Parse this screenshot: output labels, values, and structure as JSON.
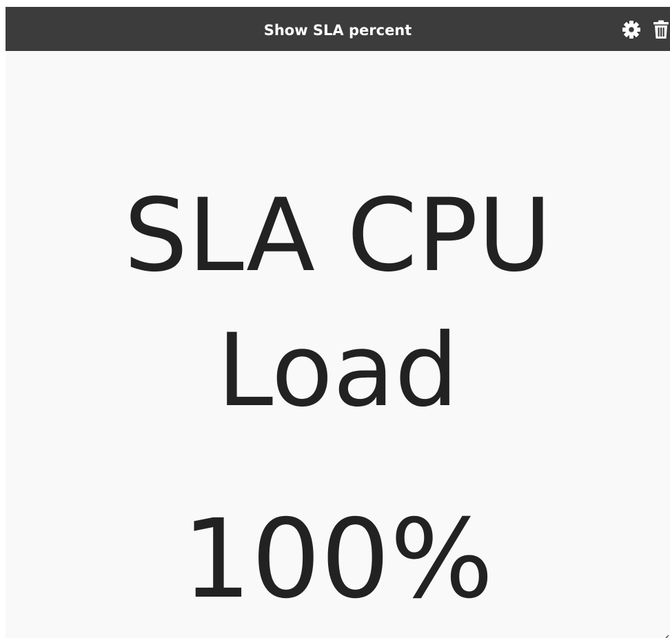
{
  "widget": {
    "title": "Show SLA percent",
    "icons": {
      "settings": "gear-icon",
      "delete": "trash-icon",
      "resize": "resize-handle-icon"
    },
    "sla": {
      "label": "SLA CPU Load",
      "value": "100%"
    }
  },
  "colors": {
    "header_background": "#3c3c3c",
    "header_text": "#ffffff",
    "body_background": "#f9f9f9",
    "body_text": "#222222"
  }
}
